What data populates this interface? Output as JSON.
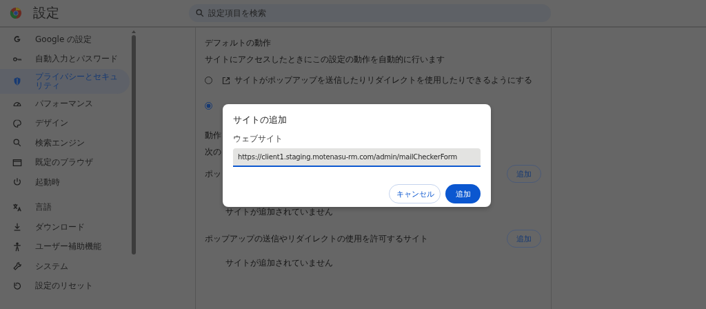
{
  "header": {
    "title": "設定",
    "search": {
      "placeholder": "設定項目を検索"
    }
  },
  "sidebar": {
    "items": [
      {
        "label": "Google の設定",
        "selected": false
      },
      {
        "label": "自動入力とパスワード",
        "selected": false
      },
      {
        "label": "プライバシーとセキュリティ",
        "selected": true
      },
      {
        "label": "パフォーマンス",
        "selected": false
      },
      {
        "label": "デザイン",
        "selected": false
      },
      {
        "label": "検索エンジン",
        "selected": false
      },
      {
        "label": "既定のブラウザ",
        "selected": false
      },
      {
        "label": "起動時",
        "selected": false
      },
      {
        "label": "言語",
        "selected": false
      },
      {
        "label": "ダウンロード",
        "selected": false
      },
      {
        "label": "ユーザー補助機能",
        "selected": false
      },
      {
        "label": "システム",
        "selected": false
      },
      {
        "label": "設定のリセット",
        "selected": false
      }
    ]
  },
  "content": {
    "default_behavior": {
      "heading": "デフォルトの動作",
      "description": "サイトにアクセスしたときにこの設定の動作を自動的に行います",
      "options": [
        {
          "label": "サイトがポップアップを送信したりリダイレクトを使用したりできるようにする",
          "selected": false
        },
        {
          "selected": true
        }
      ]
    },
    "custom": {
      "heading": "動作",
      "description": "次の"
    },
    "lists": [
      {
        "title": "ポッ",
        "button": "追加",
        "empty": "サイトが追加されていません"
      },
      {
        "title": "ポップアップの送信やリダイレクトの使用を許可するサイト",
        "button": "追加",
        "empty": "サイトが追加されていません"
      }
    ]
  },
  "dialog": {
    "title": "サイトの追加",
    "field_label": "ウェブサイト",
    "value": "https://client1.staging.motenasu-rm.com/admin/mailCheckerForm",
    "buttons": [
      {
        "label": "キャンセル",
        "kind": "secondary"
      },
      {
        "label": "追加",
        "kind": "primary"
      }
    ]
  }
}
